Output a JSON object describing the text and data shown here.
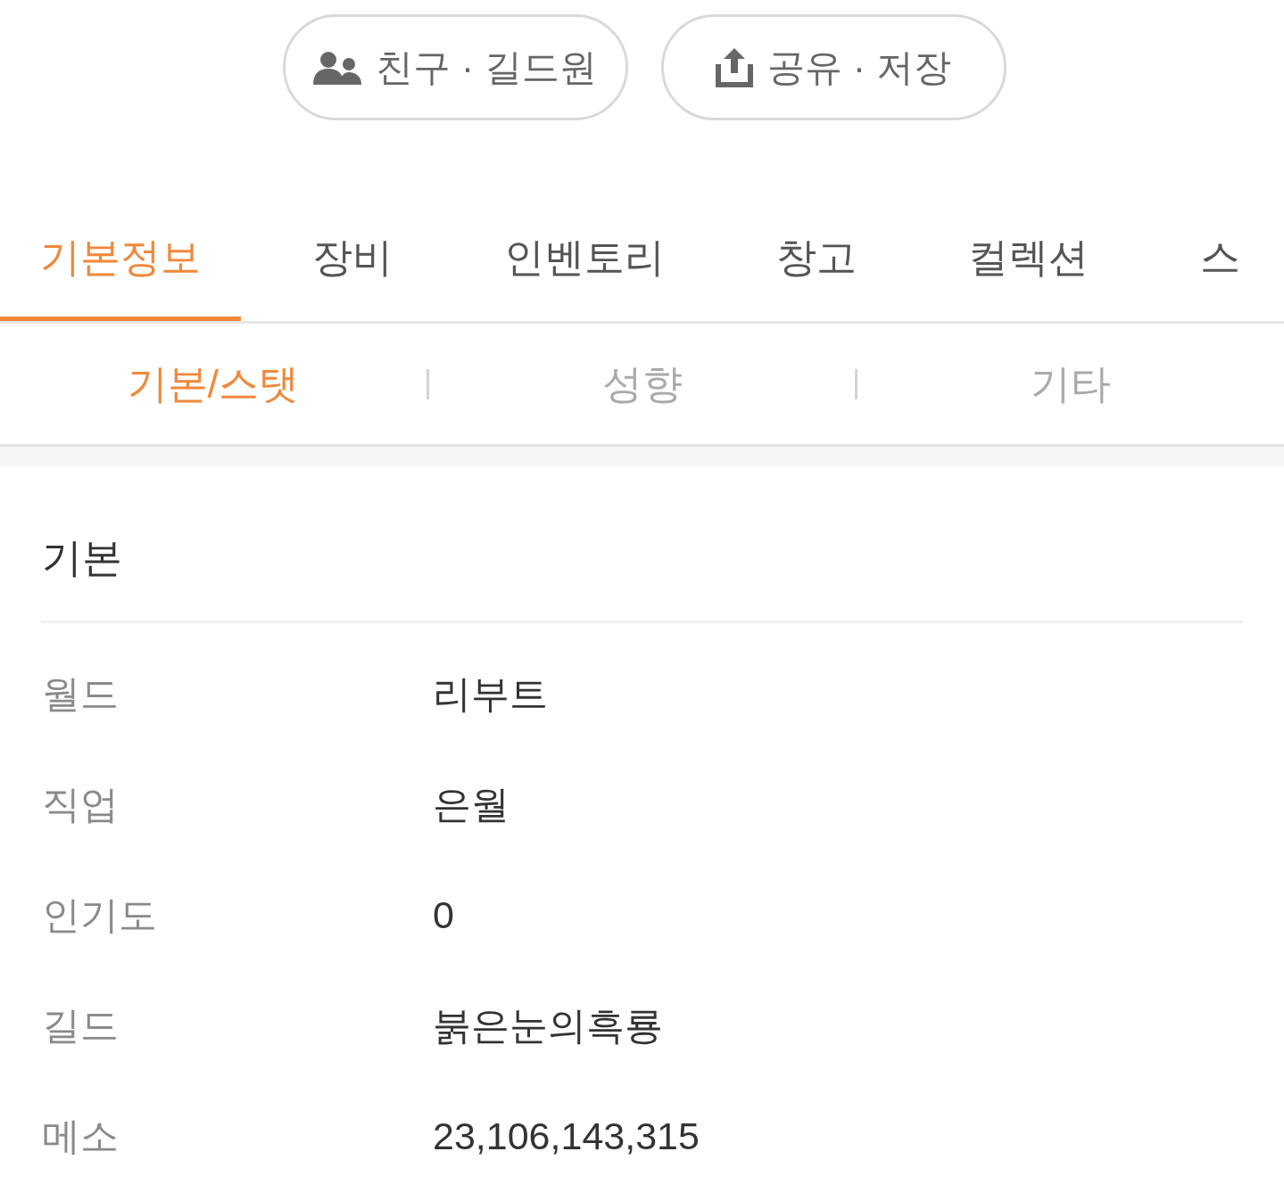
{
  "action_buttons": [
    {
      "kind": "friends",
      "label": "친구 · 길드원"
    },
    {
      "kind": "share",
      "label": "공유 · 저장"
    }
  ],
  "tabs": [
    {
      "label": "기본정보",
      "selected": true
    },
    {
      "label": "장비",
      "selected": false
    },
    {
      "label": "인벤토리",
      "selected": false
    },
    {
      "label": "창고",
      "selected": false
    },
    {
      "label": "컬렉션",
      "selected": false
    },
    {
      "label": "스",
      "selected": false
    }
  ],
  "sub_tabs": [
    {
      "label": "기본/스탯",
      "selected": true
    },
    {
      "label": "성향",
      "selected": false
    },
    {
      "label": "기타",
      "selected": false
    }
  ],
  "section": {
    "title": "기본",
    "rows": [
      {
        "label": "월드",
        "value": "리부트"
      },
      {
        "label": "직업",
        "value": "은월"
      },
      {
        "label": "인기도",
        "value": "0"
      },
      {
        "label": "길드",
        "value": "붉은눈의흑룡"
      },
      {
        "label": "메소",
        "value": "23,106,143,315"
      }
    ]
  }
}
